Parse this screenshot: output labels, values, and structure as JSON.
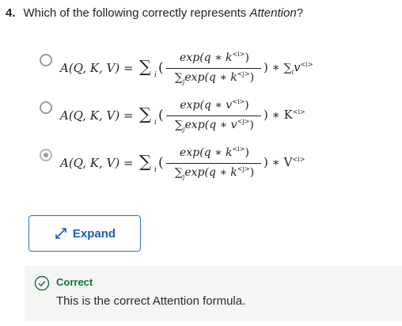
{
  "question": {
    "number": "4.",
    "text_before": "Which of the following correctly represents ",
    "text_emphasis": "Attention",
    "text_after": "?"
  },
  "options": [
    {
      "selected": false,
      "lhs": "A(Q, K, V) = ",
      "sum_symbol": "∑",
      "sum_sub": "i",
      "paren": "(",
      "numerator": "exp(q ∗ k",
      "numerator_sup": "<i>",
      "numerator_close": ")",
      "denominator_sum": "∑",
      "denominator_sub": "j",
      "denominator": "exp(q ∗ k",
      "denominator_sup": "<j>",
      "denominator_close": ")",
      "tail": ") ∗ ",
      "tail_sum": "∑",
      "tail_sub": "i",
      "tail_var": "v",
      "tail_sup": "<i>"
    },
    {
      "selected": false,
      "lhs": "A(Q, K, V) = ",
      "sum_symbol": "∑",
      "sum_sub": "i",
      "paren": "(",
      "numerator": "exp(q ∗ v",
      "numerator_sup": "<i>",
      "numerator_close": ")",
      "denominator_sum": "∑",
      "denominator_sub": "j",
      "denominator": "exp(q ∗ v",
      "denominator_sup": "<j>",
      "denominator_close": ")",
      "tail": ") ∗ K",
      "tail_sup": "<i>"
    },
    {
      "selected": true,
      "lhs": "A(Q, K, V) = ",
      "sum_symbol": "∑",
      "sum_sub": "i",
      "paren": "(",
      "numerator": "exp(q ∗ k",
      "numerator_sup": "<i>",
      "numerator_close": ")",
      "denominator_sum": "∑",
      "denominator_sub": "j",
      "denominator": "exp(q ∗ k",
      "denominator_sup": "<j>",
      "denominator_close": ")",
      "tail": ") ∗ V",
      "tail_sup": "<i>"
    }
  ],
  "expand_button": {
    "label": "Expand",
    "icon": "expand-arrows-icon"
  },
  "feedback": {
    "status": "Correct",
    "message": "This is the correct Attention formula.",
    "icon": "check-circle-icon"
  },
  "colors": {
    "accent_blue": "#1b5eb5",
    "correct_green": "#1e6d34",
    "feedback_bg": "#f4f6f4",
    "radio_border": "#9b9b9b"
  }
}
